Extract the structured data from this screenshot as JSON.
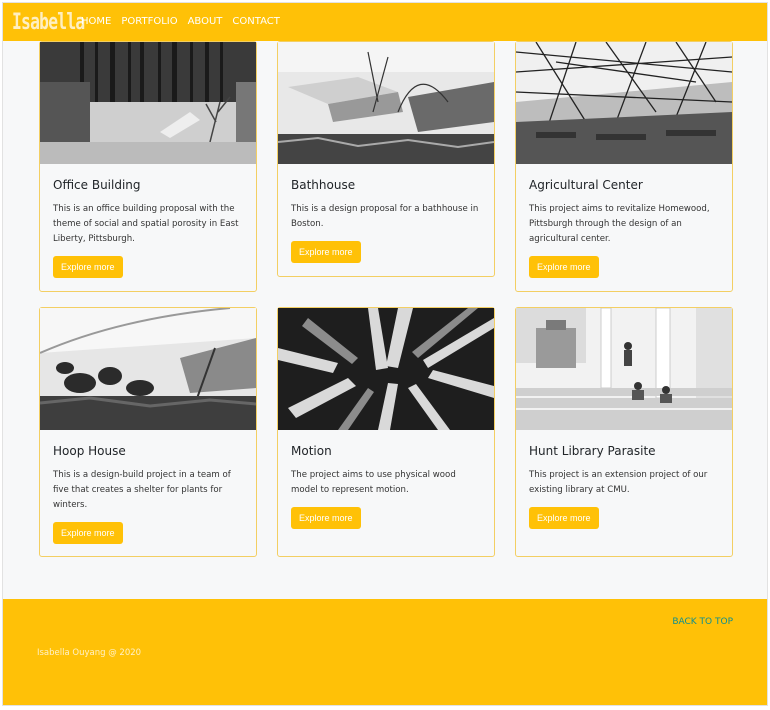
{
  "nav": {
    "logo": "Isabella",
    "links": [
      "HOME",
      "PORTFOLIO",
      "ABOUT",
      "CONTACT"
    ]
  },
  "projects": [
    {
      "title": "Office Building",
      "description": "This is an office building proposal with the theme of social and spatial porosity in East Liberty, Pittsburgh.",
      "button": "Explore more"
    },
    {
      "title": "Bathhouse",
      "description": "This is a design proposal for a bathhouse in Boston.",
      "button": "Explore more"
    },
    {
      "title": "Agricultural Center",
      "description": "This project aims to revitalize Homewood, Pittsburgh through the design of an agricultural center.",
      "button": "Explore more"
    },
    {
      "title": "Hoop House",
      "description": "This is a design-build project in a team of five that creates a shelter for plants for winters.",
      "button": "Explore more"
    },
    {
      "title": "Motion",
      "description": "The project aims to use physical wood model to represent motion.",
      "button": "Explore more"
    },
    {
      "title": "Hunt Library Parasite",
      "description": "This project is an extension project of our existing library at CMU.",
      "button": "Explore more"
    }
  ],
  "footer": {
    "back_to_top": "BACK TO TOP",
    "copyright": "Isabella Ouyang @ 2020"
  },
  "colors": {
    "accent": "#ffc107",
    "card_border": "#f3cf63",
    "footer_link": "#0d8f8f"
  }
}
